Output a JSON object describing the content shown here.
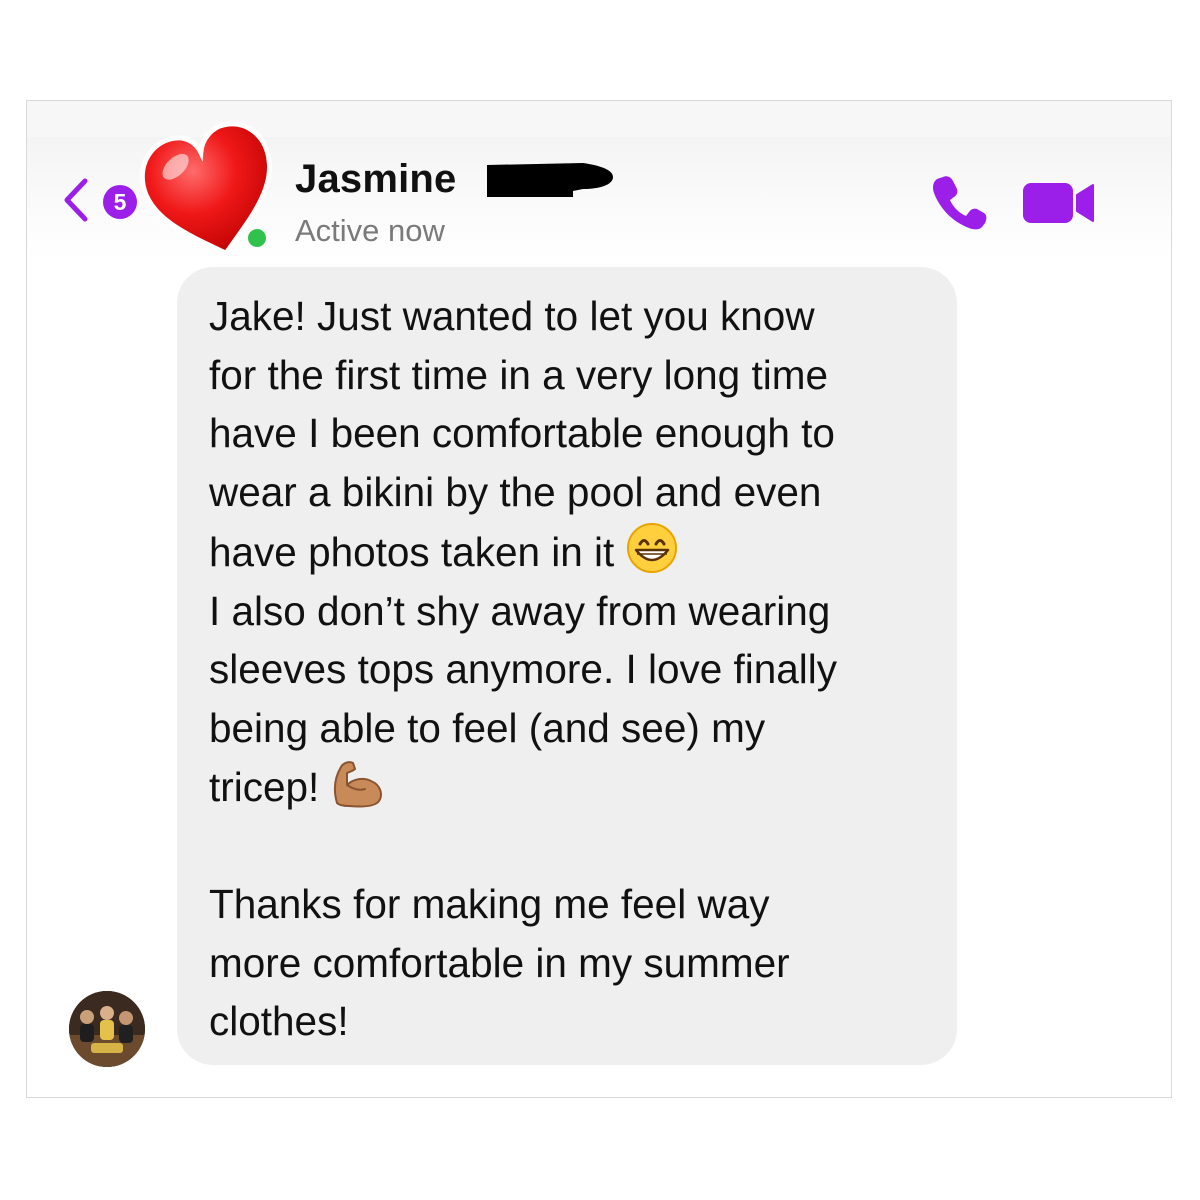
{
  "header": {
    "back_badge_count": "5",
    "contact_name": "Jasmine",
    "contact_status": "Active now",
    "icons": {
      "back": "chevron-left-icon",
      "call": "phone-icon",
      "video": "video-camera-icon",
      "avatar_sticker": "red-heart-icon"
    }
  },
  "message": {
    "lines": [
      "Jake! Just wanted to let you know",
      "for the first time in a very long time",
      "have I been comfortable enough to",
      "wear a bikini by the pool and even",
      "have photos taken in it",
      "I also don’t shy away from wearing",
      "sleeves tops anymore. I love finally",
      "being able to feel (and see) my",
      "tricep!",
      "",
      "Thanks for making me feel way",
      "more comfortable in my summer",
      "clothes!"
    ],
    "emojis": {
      "grinning": "grinning-face-emoji",
      "flexed": "flexed-biceps-emoji"
    }
  },
  "colors": {
    "accent": "#9b1fe8",
    "bubble": "#efefef",
    "status_text": "#7a7a7a",
    "online": "#31c24d"
  }
}
